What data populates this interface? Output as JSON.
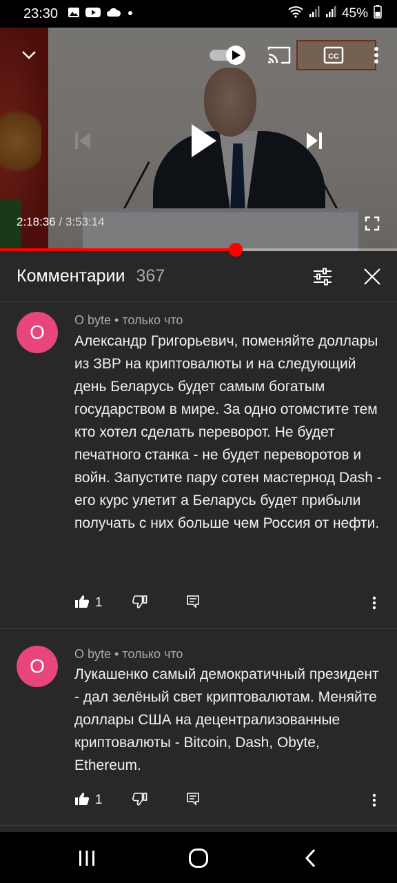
{
  "status_bar": {
    "time": "23:30",
    "battery": "45%",
    "icons_left": [
      "gallery-icon",
      "youtube-icon",
      "cloud-icon",
      "dot-icon"
    ],
    "icons_right": [
      "wifi-icon",
      "signal-icon",
      "signal-icon",
      "battery-icon"
    ]
  },
  "player": {
    "current_time": "2:18:36",
    "separator": " / ",
    "total_time": "3:53:14",
    "progress_fraction": 0.593,
    "controls": [
      "collapse-icon",
      "autoplay-toggle",
      "cast-icon",
      "captions-icon",
      "more-vert-icon",
      "previous-icon",
      "play-icon",
      "next-icon",
      "fullscreen-icon"
    ]
  },
  "comments": {
    "title": "Комментарии",
    "count": "367",
    "items": [
      {
        "avatar_letter": "O",
        "author": "O byte",
        "bullet": " • ",
        "time": "только что",
        "text": "Александр Григорьевич,  поменяйте доллары из ЗВР на криптовалюты и на следующий день Беларусь будет самым богатым государством в мире. За одно отомстите тем кто хотел сделать переворот. Не будет печатного станка - не будет переворотов и войн. Запустите пару сотен мастернод Dash - его курс улетит а Беларусь будет прибыли получать с них больше чем Россия от нефти.",
        "likes": "1"
      },
      {
        "avatar_letter": "O",
        "author": "O byte",
        "bullet": " • ",
        "time": "только что",
        "text": "Лукашенко самый демократичный президент - дал зелёный свет криптовалютам. Меняйте доллары США на децентрализованные криптовалюты - Bitcoin, Dash, Obyte, Ethereum.",
        "likes": "1"
      }
    ]
  },
  "colors": {
    "accent_red": "#ff0000",
    "avatar_pink": "#e8457a",
    "background": "#282828"
  }
}
